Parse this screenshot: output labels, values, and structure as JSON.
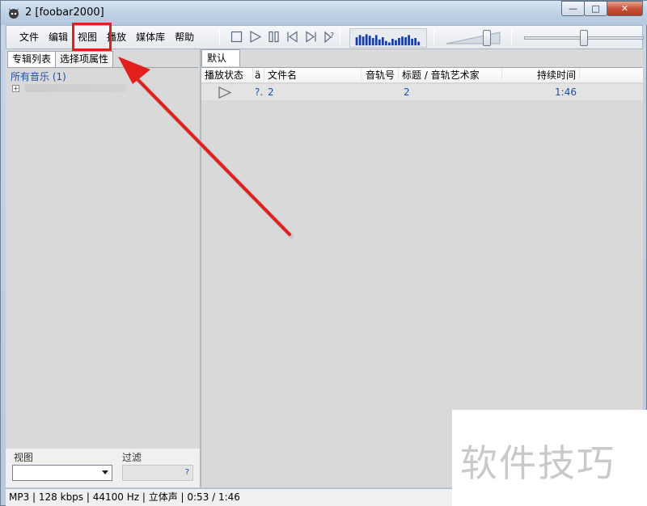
{
  "window": {
    "title": "2  [foobar2000]",
    "minimize": "—",
    "maximize": "□",
    "close": "✕"
  },
  "menu": [
    "文件",
    "编辑",
    "视图",
    "播放",
    "媒体库",
    "帮助"
  ],
  "highlighted_menu": "视图",
  "transport_icons": [
    "stop-icon",
    "play-icon",
    "pause-icon",
    "previous-icon",
    "next-icon",
    "random-icon"
  ],
  "visualization": {
    "bars": [
      0.55,
      0.7,
      0.6,
      0.75,
      0.65,
      0.5,
      0.7,
      0.4,
      0.55,
      0.3,
      0.2,
      0.45,
      0.35,
      0.5,
      0.6,
      0.55,
      0.7,
      0.45,
      0.5,
      0.25
    ],
    "color": "#1a3fa0"
  },
  "volume_level": 0.75,
  "seek_position": 0.5,
  "left_panel": {
    "tabs": [
      "专辑列表",
      "选择项属性"
    ],
    "tree_root": "所有音乐 (1)",
    "view_label": "视图",
    "filter_label": "过滤",
    "filter_help": "?"
  },
  "playlist": {
    "tab": "默认",
    "columns": [
      "播放状态",
      "ä",
      "文件名",
      "音轨号",
      "标题 / 音轨艺术家",
      "持续时间"
    ],
    "rows": [
      {
        "status": "",
        "a": "?.",
        "filename": "2",
        "track_no": "",
        "title": "2",
        "duration": "1:46"
      }
    ]
  },
  "status_bar": "MP3 | 128 kbps | 44100 Hz | 立体声 | 0:53 / 1:46",
  "watermark": "软件技巧",
  "colors": {
    "accent_red": "#e1201c",
    "link_blue": "#1c4fa8"
  }
}
